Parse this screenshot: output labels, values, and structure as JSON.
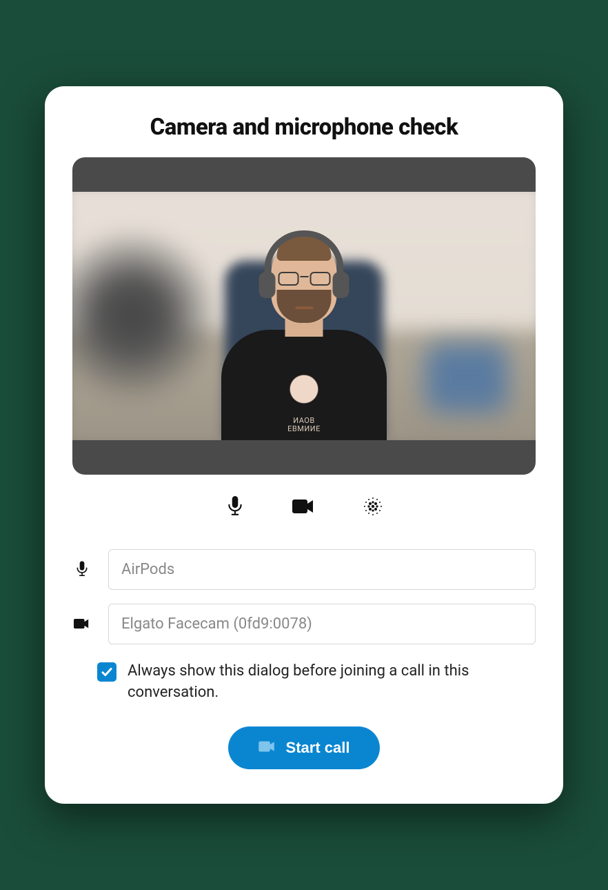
{
  "dialog": {
    "title": "Camera and microphone check"
  },
  "preview": {
    "description": "camera-preview",
    "tshirt_text_line1": "ИАОB",
    "tshirt_text_line2": "ЕВМИИЕ"
  },
  "controls": {
    "mic_icon": "microphone-icon",
    "camera_icon": "camera-icon",
    "blur_icon": "blur-icon"
  },
  "devices": {
    "microphone": {
      "icon": "microphone-icon",
      "selected": "AirPods"
    },
    "camera": {
      "icon": "camera-icon",
      "selected": "Elgato Facecam (0fd9:0078)"
    }
  },
  "checkbox": {
    "checked": true,
    "label": "Always show this dialog before joining a call in this conversation."
  },
  "actions": {
    "start_call_label": "Start call"
  },
  "colors": {
    "accent": "#0a86d1",
    "dialog_bg": "#ffffff",
    "preview_bg": "#4a4a4a"
  }
}
